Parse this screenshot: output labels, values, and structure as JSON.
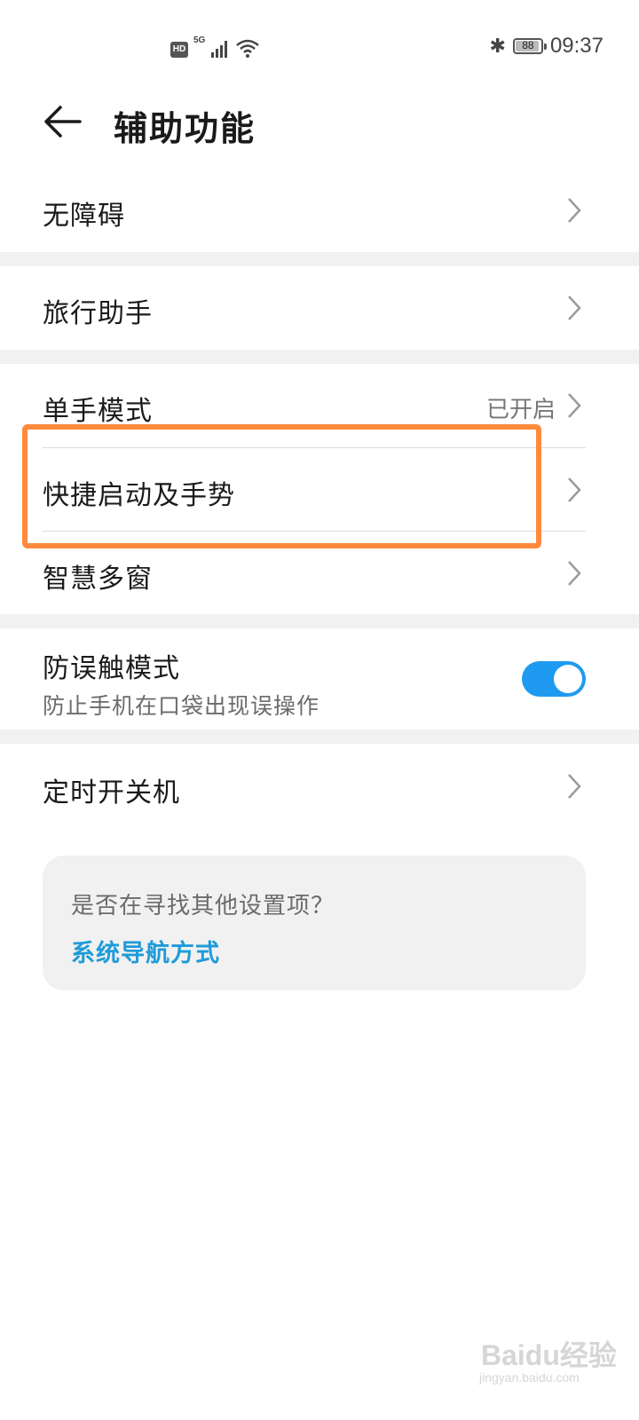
{
  "status_bar": {
    "hd_label": "HD",
    "network_label": "5G",
    "battery_level": "88",
    "time": "09:37"
  },
  "header": {
    "title": "辅助功能"
  },
  "settings": {
    "accessibility": {
      "label": "无障碍"
    },
    "travel_assistant": {
      "label": "旅行助手"
    },
    "one_hand_mode": {
      "label": "单手模式",
      "value": "已开启"
    },
    "shortcuts_gestures": {
      "label": "快捷启动及手势"
    },
    "smart_multiwindow": {
      "label": "智慧多窗"
    },
    "pocket_mode": {
      "label": "防误触模式",
      "description": "防止手机在口袋出现误操作",
      "enabled": true
    },
    "scheduled_power": {
      "label": "定时开关机"
    }
  },
  "suggestion": {
    "question": "是否在寻找其他设置项？",
    "link": "系统导航方式"
  },
  "watermark": {
    "brand": "Baidu经验",
    "url": "jingyan.baidu.com"
  },
  "colors": {
    "accent": "#1e9bf0",
    "highlight": "#ff8a3d",
    "link": "#1e9bd8"
  }
}
